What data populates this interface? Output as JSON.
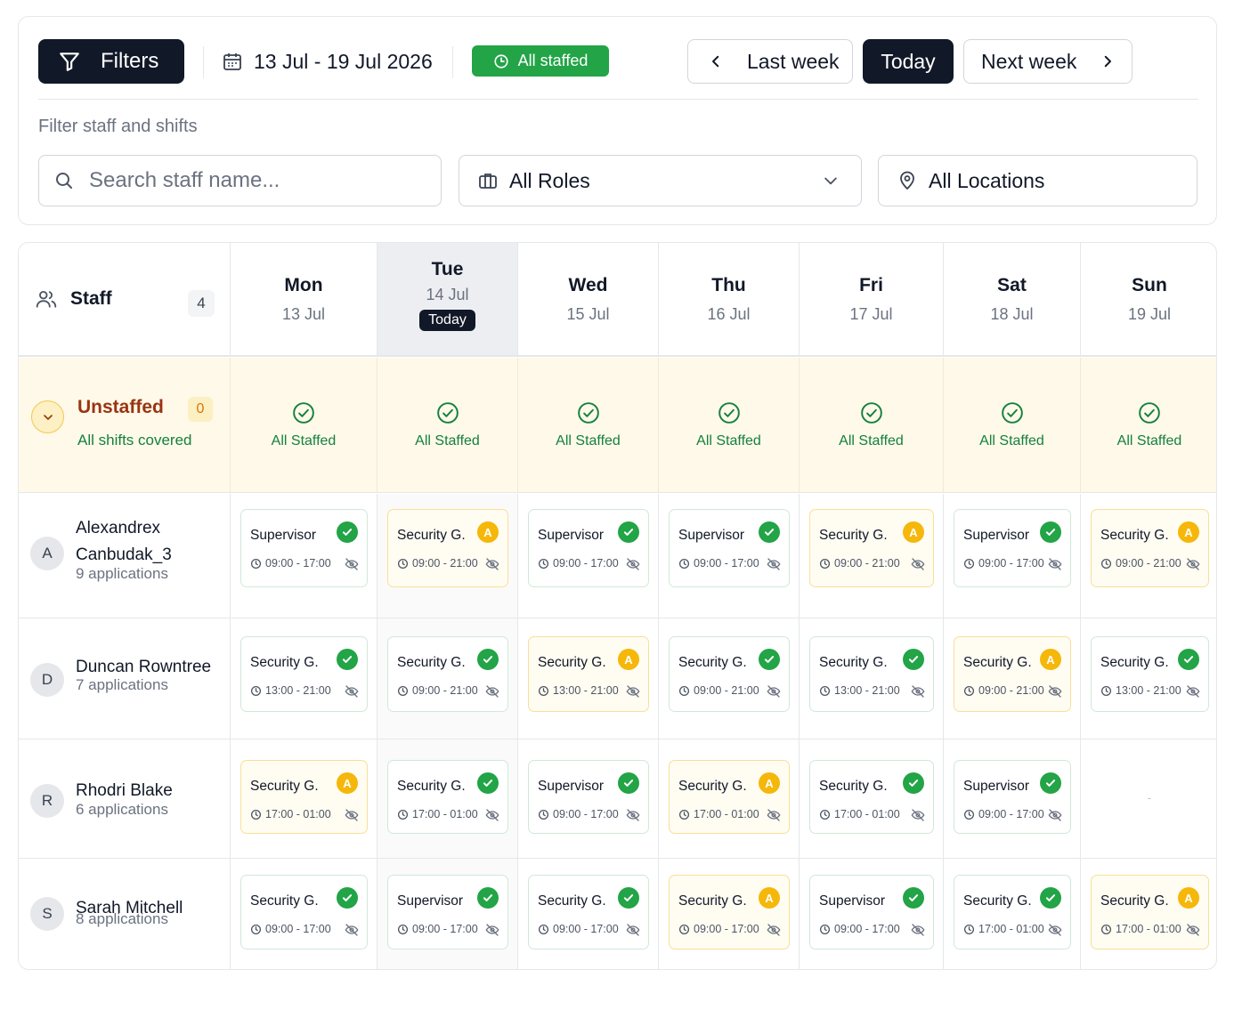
{
  "toolbar": {
    "filters_label": "Filters",
    "date_range": "13 Jul - 19 Jul 2026",
    "staffed_badge": "All staffed",
    "last_week": "Last week",
    "today": "Today",
    "next_week": "Next week"
  },
  "filters": {
    "label": "Filter staff and shifts",
    "search_placeholder": "Search staff name...",
    "roles_value": "All Roles",
    "locations_value": "All Locations"
  },
  "grid": {
    "staff_header": "Staff",
    "staff_count": "4",
    "days": [
      {
        "name": "Mon",
        "date": "13 Jul"
      },
      {
        "name": "Tue",
        "date": "14 Jul",
        "today_label": "Today"
      },
      {
        "name": "Wed",
        "date": "15 Jul"
      },
      {
        "name": "Thu",
        "date": "16 Jul"
      },
      {
        "name": "Fri",
        "date": "17 Jul"
      },
      {
        "name": "Sat",
        "date": "18 Jul"
      },
      {
        "name": "Sun",
        "date": "19 Jul"
      }
    ],
    "unstaffed": {
      "title": "Unstaffed",
      "count": "0",
      "subtitle": "All shifts covered",
      "day_status": "All Staffed"
    },
    "staff": [
      {
        "initial": "A",
        "name": "Alexandrex Canbudak_3",
        "applications": "9 applications",
        "shifts": [
          {
            "role": "Supervisor",
            "time": "09:00 - 17:00",
            "status": "ok"
          },
          {
            "role": "Security G.",
            "time": "09:00 - 21:00",
            "status": "A"
          },
          {
            "role": "Supervisor",
            "time": "09:00 - 17:00",
            "status": "ok"
          },
          {
            "role": "Supervisor",
            "time": "09:00 - 17:00",
            "status": "ok"
          },
          {
            "role": "Security G.",
            "time": "09:00 - 21:00",
            "status": "A"
          },
          {
            "role": "Supervisor",
            "time": "09:00 - 17:00",
            "status": "ok"
          },
          {
            "role": "Security G.",
            "time": "09:00 - 21:00",
            "status": "A"
          }
        ]
      },
      {
        "initial": "D",
        "name": "Duncan Rowntree",
        "applications": "7 applications",
        "shifts": [
          {
            "role": "Security G.",
            "time": "13:00 - 21:00",
            "status": "ok"
          },
          {
            "role": "Security G.",
            "time": "09:00 - 21:00",
            "status": "ok"
          },
          {
            "role": "Security G.",
            "time": "13:00 - 21:00",
            "status": "A"
          },
          {
            "role": "Security G.",
            "time": "09:00 - 21:00",
            "status": "ok"
          },
          {
            "role": "Security G.",
            "time": "13:00 - 21:00",
            "status": "ok"
          },
          {
            "role": "Security G.",
            "time": "09:00 - 21:00",
            "status": "A"
          },
          {
            "role": "Security G.",
            "time": "13:00 - 21:00",
            "status": "ok"
          }
        ]
      },
      {
        "initial": "R",
        "name": "Rhodri Blake",
        "applications": "6 applications",
        "shifts": [
          {
            "role": "Security G.",
            "time": "17:00 - 01:00",
            "status": "A"
          },
          {
            "role": "Security G.",
            "time": "17:00 - 01:00",
            "status": "ok"
          },
          {
            "role": "Supervisor",
            "time": "09:00 - 17:00",
            "status": "ok"
          },
          {
            "role": "Security G.",
            "time": "17:00 - 01:00",
            "status": "A"
          },
          {
            "role": "Security G.",
            "time": "17:00 - 01:00",
            "status": "ok"
          },
          {
            "role": "Supervisor",
            "time": "09:00 - 17:00",
            "status": "ok"
          },
          null
        ]
      },
      {
        "initial": "S",
        "name": "Sarah Mitchell",
        "applications": "8 applications",
        "shifts": [
          {
            "role": "Security G.",
            "time": "09:00 - 17:00",
            "status": "ok"
          },
          {
            "role": "Supervisor",
            "time": "09:00 - 17:00",
            "status": "ok"
          },
          {
            "role": "Security G.",
            "time": "09:00 - 17:00",
            "status": "ok"
          },
          {
            "role": "Security G.",
            "time": "09:00 - 17:00",
            "status": "A"
          },
          {
            "role": "Supervisor",
            "time": "09:00 - 17:00",
            "status": "ok"
          },
          {
            "role": "Security G.",
            "time": "17:00 - 01:00",
            "status": "ok"
          },
          {
            "role": "Security G.",
            "time": "17:00 - 01:00",
            "status": "A"
          }
        ]
      }
    ],
    "empty_marker": "-"
  },
  "colors": {
    "primary_dark": "#111827",
    "success": "#22a447",
    "warning": "#f5b70a",
    "unstaffed_bg": "#fef9e9"
  }
}
